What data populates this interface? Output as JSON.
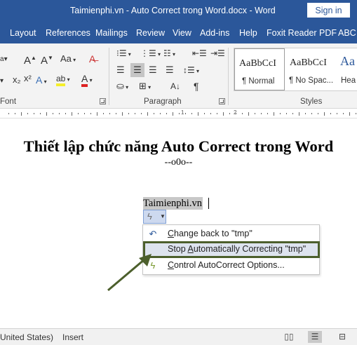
{
  "window": {
    "title": "Taimienphi.vn - Auto Correct trong Word.docx  -  Word",
    "signin_label": "Sign in"
  },
  "tabs": [
    "Layout",
    "References",
    "Mailings",
    "Review",
    "View",
    "Add-ins",
    "Help",
    "Foxit Reader PDF",
    "ABC"
  ],
  "ribbon": {
    "font_group_label": "Font",
    "paragraph_group_label": "Paragraph",
    "styles_group_label": "Styles",
    "font_icons": {
      "size_down": "a",
      "aa_label": "Aa",
      "subscript": "x₂",
      "superscript": "x²",
      "text_effects": "A",
      "highlight": "ab",
      "font_color": "A"
    },
    "paragraph_icons": {
      "pilcrow": "¶"
    },
    "styles": [
      {
        "sample": "AaBbCcI",
        "name": "¶ Normal",
        "selected": true
      },
      {
        "sample": "AaBbCcI",
        "name": "¶ No Spac...",
        "selected": false
      },
      {
        "sample": "Aa",
        "name": "Hea",
        "selected": false
      }
    ],
    "ruler_numbers": [
      "1",
      "2"
    ]
  },
  "document": {
    "heading": "Thiết lập chức năng Auto Correct trong Word",
    "subheading": "--o0o--",
    "typed_word": "Taimienphi.vn"
  },
  "autocorrect_menu": {
    "items": [
      {
        "icon": "undo-arrow-icon",
        "label": "Change back to \"tmp\"",
        "highlighted": false
      },
      {
        "icon": "none",
        "label": "Stop Automatically Correcting \"tmp\"",
        "highlighted": true
      },
      {
        "icon": "autocorrect-bolt-icon",
        "label": "Control AutoCorrect Options...",
        "highlighted": false
      }
    ]
  },
  "statusbar": {
    "language": "United States)",
    "mode": "Insert"
  },
  "colors": {
    "title_blue": "#2b579a",
    "highlight_outline": "#4c5f2c",
    "menu_highlight": "#dde3ee",
    "pointer_arrow": "#4c5f2c"
  }
}
